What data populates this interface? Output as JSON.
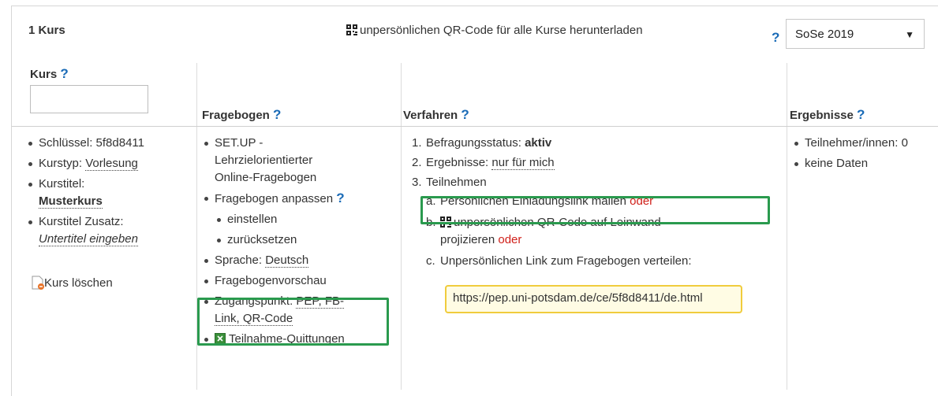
{
  "header": {
    "count_label": "1 Kurs",
    "qr_all_label": "unpersönlichen QR-Code für alle Kurse herunterladen",
    "semester_help": "?",
    "semester_selected": "SoSe 2019",
    "semester_arrow": "▼"
  },
  "columns": {
    "kurs": "Kurs",
    "fragebogen": "Fragebogen",
    "verfahren": "Verfahren",
    "ergebnisse": "Ergebnisse",
    "help": "?"
  },
  "kurs": {
    "schluessel_label": "Schlüssel: 5f8d8411",
    "kurstyp_label": "Kurstyp: ",
    "kurstyp_value": "Vorlesung",
    "kurstitel_label": "Kurstitel:",
    "kurstitel_value": "Musterkurs",
    "zusatz_label": "Kurstitel Zusatz:",
    "zusatz_value": "Untertitel eingeben",
    "delete_label": "Kurs löschen"
  },
  "fragebogen": {
    "name_line1": "SET.UP -",
    "name_line2": "Lehrzielorientierter",
    "name_line3": "Online-Fragebogen",
    "anpassen_label": "Fragebogen anpassen",
    "einstellen": "einstellen",
    "zuruecksetzen": "zurücksetzen",
    "sprache_label": "Sprache: ",
    "sprache_value": "Deutsch",
    "vorschau": "Fragebogenvorschau",
    "zugang_label": "Zugangspunkt: ",
    "zugang_value1": "PEP, FB-",
    "zugang_value2": "Link, QR-Code",
    "quittungen": "Teilnahme-Quittungen"
  },
  "verfahren": {
    "n1": "1.",
    "status_label": "Befragungsstatus: ",
    "status_value": "aktiv",
    "n2": "2.",
    "ergebnisse_label": "Ergebnisse: ",
    "ergebnisse_value": "nur für mich",
    "n3": "3.",
    "teilnehmen": "Teilnehmen",
    "a_marker": "a.",
    "a_text": "Persönlichen Einladungslink mailen ",
    "oder": "oder",
    "b_marker": "b.",
    "b_text1": "unpersönlichen QR-Code auf Leinwand",
    "b_text2": "projizieren ",
    "c_marker": "c.",
    "c_text": "Unpersönlichen Link zum Fragebogen verteilen:",
    "link": "https://pep.uni-potsdam.de/ce/5f8d8411/de.html"
  },
  "ergebnisse": {
    "teilnehmer": "Teilnehmer/innen: 0",
    "keine_daten": "keine Daten"
  },
  "colors": {
    "help_blue": "#1a6bb7",
    "highlight_green": "#2a9a4e",
    "highlight_yellow": "#f0cc3c",
    "oder_red": "#d0201a"
  }
}
